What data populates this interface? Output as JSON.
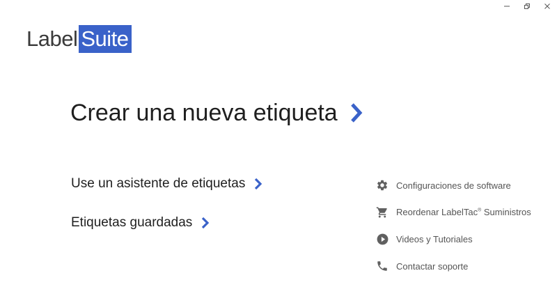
{
  "window": {
    "controls": {
      "minimize": "minimize-icon",
      "restore": "restore-icon",
      "close": "close-icon"
    }
  },
  "logo": {
    "part1": "Label",
    "part2": "Suite",
    "accent_color": "#3a62c9"
  },
  "main": {
    "create_label": "Crear una nueva etiqueta",
    "wizard_label": "Use un asistente de etiquetas",
    "saved_label": "Etiquetas guardadas",
    "chevron_color": "#3a62c9"
  },
  "side_menu": {
    "items": [
      {
        "icon": "gear-icon",
        "label": "Configuraciones de software"
      },
      {
        "icon": "cart-icon",
        "label_before": "Reordenar LabelTac",
        "label_sup": "®",
        "label_after": " Suministros"
      },
      {
        "icon": "play-icon",
        "label": "Videos y Tutoriales"
      },
      {
        "icon": "phone-icon",
        "label": "Contactar soporte"
      }
    ]
  }
}
